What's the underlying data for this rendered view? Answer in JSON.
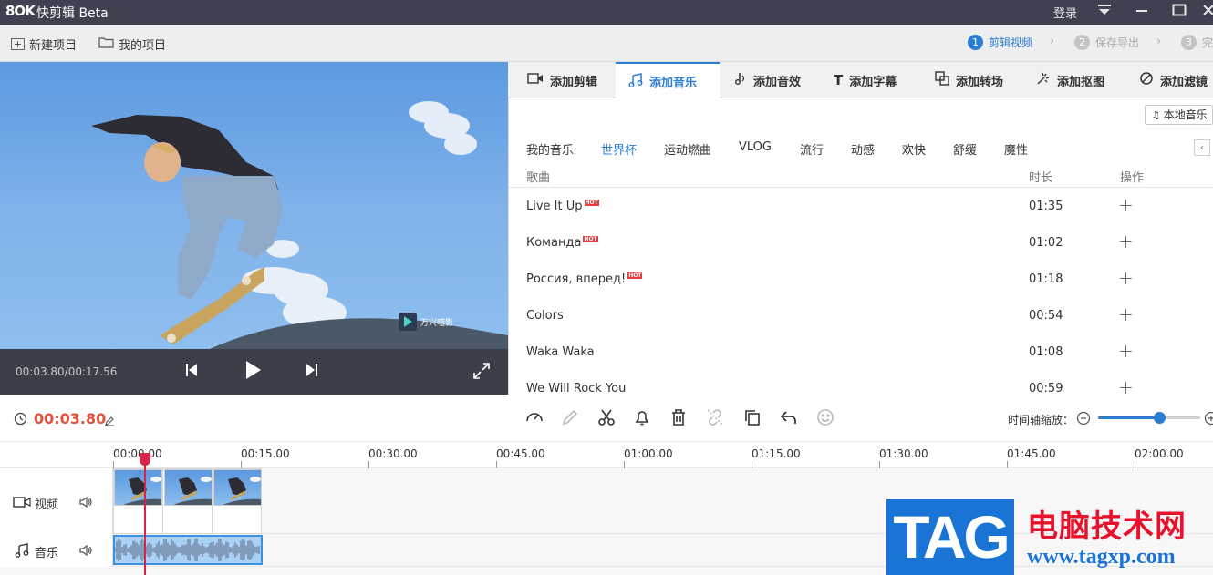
{
  "titlebar": {
    "logo": "8OK",
    "title": "快剪辑 Beta",
    "login": "登录",
    "icons": [
      "dropdown-icon",
      "minimize-icon",
      "maximize-icon",
      "close-icon"
    ]
  },
  "toolbar": {
    "new_project": "新建项目",
    "my_projects": "我的项目",
    "steps": [
      {
        "num": "1",
        "label": "剪辑视频",
        "active": true
      },
      {
        "num": "2",
        "label": "保存导出",
        "active": false
      },
      {
        "num": "3",
        "label": "完",
        "active": false
      }
    ],
    "accent": "#2b7cd3"
  },
  "preview": {
    "watermark": "万兴喵影",
    "timecode": "00:03.80/00:17.56"
  },
  "tabs": [
    {
      "label": "添加剪辑",
      "icon": "video-icon"
    },
    {
      "label": "添加音乐",
      "icon": "music-note-icon",
      "active": true
    },
    {
      "label": "添加音效",
      "icon": "sound-effect-icon"
    },
    {
      "label": "添加字幕",
      "icon": "text-icon"
    },
    {
      "label": "添加转场",
      "icon": "transition-icon"
    },
    {
      "label": "添加抠图",
      "icon": "cutout-icon"
    },
    {
      "label": "添加滤镜",
      "icon": "filter-icon"
    }
  ],
  "local_music": "本地音乐",
  "categories": [
    {
      "label": "我的音乐"
    },
    {
      "label": "世界杯",
      "active": true
    },
    {
      "label": "运动燃曲"
    },
    {
      "label": "VLOG"
    },
    {
      "label": "流行"
    },
    {
      "label": "动感"
    },
    {
      "label": "欢快"
    },
    {
      "label": "舒缓"
    },
    {
      "label": "魔性"
    }
  ],
  "columns": {
    "song": "歌曲",
    "duration": "时长",
    "action": "操作"
  },
  "songs": [
    {
      "title": "Live It Up",
      "hot": "HOT",
      "duration": "01:35"
    },
    {
      "title": "Команда",
      "hot": "HOT",
      "duration": "01:02"
    },
    {
      "title": "Россия, вперед!",
      "hot": "HOT",
      "duration": "01:18"
    },
    {
      "title": "Colors",
      "hot": "",
      "duration": "00:54"
    },
    {
      "title": "Waka Waka",
      "hot": "",
      "duration": "01:08"
    },
    {
      "title": "We Will Rock You",
      "hot": "",
      "duration": "00:59"
    }
  ],
  "timeline": {
    "current_time": "00:03.80",
    "zoom_label": "时间轴缩放：",
    "zoom_level": 0.6,
    "ticks": [
      "00:00.00",
      "00:15.00",
      "00:30.00",
      "00:45.00",
      "01:00.00",
      "01:15.00",
      "01:30.00",
      "01:45.00",
      "02:00.00"
    ],
    "video_track": "视频",
    "music_track": "音乐",
    "tools": [
      "speed-icon",
      "edit-icon",
      "scissors-icon",
      "bell-icon",
      "trash-icon",
      "unlink-icon",
      "copy-icon",
      "undo-icon",
      "face-icon"
    ]
  },
  "watermark": {
    "tag": "TAG",
    "cn": "电脑技术网",
    "url": "www.tagxp.com"
  }
}
